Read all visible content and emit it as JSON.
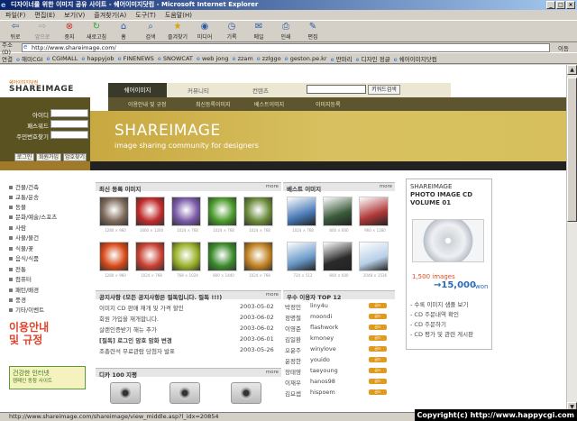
{
  "window": {
    "title": "디자이너를 위한 이미지 공유 사이트 - 쉐어이미지닷컴 - Microsoft Internet Explorer"
  },
  "menu": [
    "파일(F)",
    "편집(E)",
    "보기(V)",
    "즐겨찾기(A)",
    "도구(T)",
    "도움말(H)"
  ],
  "toolbar": [
    {
      "label": "뒤로",
      "icon": "back-arrow-icon"
    },
    {
      "label": "앞으로",
      "icon": "forward-arrow-icon"
    },
    {
      "label": "중지",
      "icon": "stop-icon"
    },
    {
      "label": "새로고침",
      "icon": "refresh-icon"
    },
    {
      "label": "홈",
      "icon": "home-icon"
    },
    {
      "label": "검색",
      "icon": "search-icon"
    },
    {
      "label": "즐겨찾기",
      "icon": "favorites-icon"
    },
    {
      "label": "미디어",
      "icon": "media-icon"
    },
    {
      "label": "기록",
      "icon": "history-icon"
    },
    {
      "label": "메일",
      "icon": "mail-icon"
    },
    {
      "label": "인쇄",
      "icon": "print-icon"
    },
    {
      "label": "편집",
      "icon": "edit-icon"
    }
  ],
  "address": {
    "label": "주소(D)",
    "url": "http://www.shareimage.com/",
    "go": "이동"
  },
  "links": {
    "label": "연결",
    "items": [
      "해미CGI",
      "CGIMALL",
      "happyjob",
      "FINENEWS",
      "SNOWCAT",
      "web jong",
      "zzam",
      "zzlggo",
      "geston.pe.kr",
      "딴마리",
      "디자인 정글",
      "쉐어이미지닷컴"
    ]
  },
  "site": {
    "logo_small": "쉐어이미지닷컴",
    "logo": "SHAREIMAGE",
    "gnb": [
      "쉐어이미지",
      "커뮤니티",
      "컨텐츠"
    ],
    "search_btn": "키워드검색",
    "subnav": [
      "이용안내 및 규정",
      "최신등록이미지",
      "베스트이미지",
      "이미지등록"
    ],
    "banner_title": "SHAREIMAGE",
    "banner_sub": "image sharing community for designers",
    "login": {
      "id": "아이디",
      "pw": "패스워드",
      "auto": "주민번호찾기",
      "btn_login": "로그인",
      "btn_join": "회원가입",
      "btn_find": "암호찾기"
    },
    "categories": [
      "건물/건축",
      "교통/운송",
      "동물",
      "문화/예술/스포츠",
      "사람",
      "사물/물건",
      "식물/꽃",
      "음식/식품",
      "전통",
      "컴퓨터",
      "패턴/배경",
      "풍경",
      "기타/이벤트"
    ],
    "promo": [
      "이용안내",
      "및 규정"
    ],
    "badge": [
      "건강한 인터넷",
      "캠페인 동참 사이트"
    ],
    "new_title": "최신 등록 이미지",
    "best_title": "베스트 이미지",
    "more": "more",
    "new_thumbs": [
      {
        "res": "1280 × 960",
        "color": "#7d6a5a"
      },
      {
        "res": "1600 × 1200",
        "color": "#c02a2a"
      },
      {
        "res": "1024 × 768",
        "color": "#7a5aa8"
      },
      {
        "res": "1024 × 768",
        "color": "#4a9a2a"
      },
      {
        "res": "1024 × 768",
        "color": "#6a8a3a"
      },
      {
        "res": "1280 × 960",
        "color": "#d84818"
      },
      {
        "res": "1024 × 768",
        "color": "#c84030"
      },
      {
        "res": "768 × 1024",
        "color": "#98b028"
      },
      {
        "res": "800 × 1440",
        "color": "#3a8a2a"
      },
      {
        "res": "1024 × 768",
        "color": "#c08020"
      }
    ],
    "best_thumbs": [
      {
        "res": "1024 × 768",
        "color": "#4a7ab8"
      },
      {
        "res": "800 × 600",
        "color": "#3a5a3a"
      },
      {
        "res": "960 × 1280",
        "color": "#b03838"
      },
      {
        "res": "724 × 512",
        "color": "#6a9ac8"
      },
      {
        "res": "800 × 600",
        "color": "#2a2a2a"
      },
      {
        "res": "2048 × 1536",
        "color": "#b8d0e8"
      }
    ],
    "notice_title": "공지사항 (모든 공지사항은 필독입니다. 필독 !!!)",
    "notices": [
      {
        "t": "이미지 CD 판매 재개 및 가격 할인",
        "d": "2003-05-02"
      },
      {
        "t": "회원 가입을 재개합니다.",
        "d": "2003-06-02"
      },
      {
        "t": "살랜인증받기 해뉴 추가",
        "d": "2003-06-02"
      },
      {
        "t": "[필독] 로그인 암호 암화 변경",
        "d": "2003-06-01"
      },
      {
        "t": "조총련석 무료관람 당첨자 발표",
        "d": "2003-05-26"
      }
    ],
    "users_title": "우수 이용자 TOP 12",
    "users": [
      {
        "n": "박정민",
        "id": "liny4u"
      },
      {
        "n": "정명철",
        "id": "moondi"
      },
      {
        "n": "이영준",
        "id": "flashwork"
      },
      {
        "n": "김일환",
        "id": "kmoney"
      },
      {
        "n": "오윤주",
        "id": "winylove"
      },
      {
        "n": "윤정한",
        "id": "youido"
      },
      {
        "n": "장태영",
        "id": "taeyoung"
      },
      {
        "n": "이재우",
        "id": "hanos98"
      },
      {
        "n": "김요셉",
        "id": "hispoem"
      }
    ],
    "grade": "골드",
    "camera_title": "디카 100 지평",
    "ad": {
      "l1": "SHAREIMAGE",
      "l2": "PHOTO IMAGE CD",
      "l3": "VOLUME 01",
      "count": "1,500 images",
      "price": "→15,000",
      "won": "won"
    },
    "ad_list": [
      "수록 이미지 샘플 보기",
      "CD 주문내역 확인",
      "CD 주문하기",
      "CD 평가 및 관련 게시판"
    ]
  },
  "status": {
    "url": "http://www.shareimage.com/shareimage/view_middle.asp?l_idx=20854",
    "copy": "Copyright(c) http://www.happycgi.com"
  }
}
